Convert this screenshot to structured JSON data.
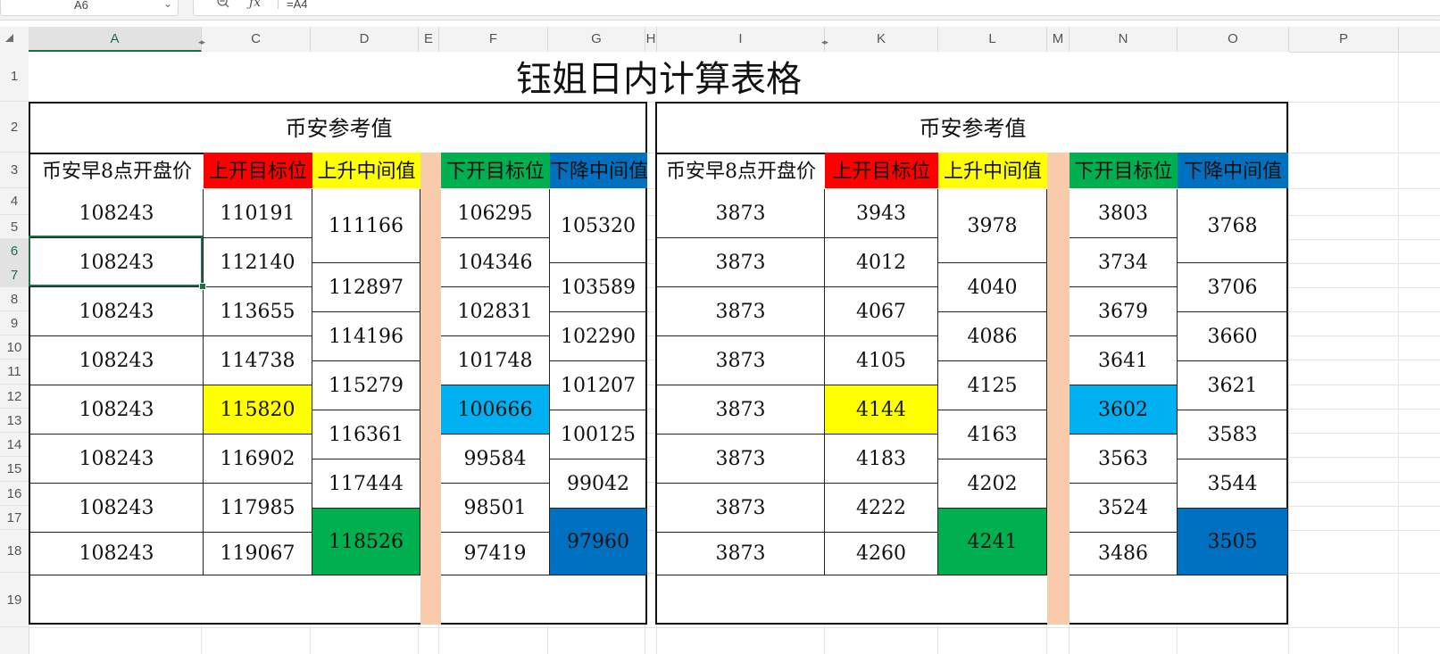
{
  "name_box": {
    "cell": "A6"
  },
  "formula": {
    "text": "=A4"
  },
  "colors": {
    "red": "#ff0000",
    "yellow": "#ffff00",
    "green": "#00b050",
    "blue": "#0070c0",
    "lightblue": "#00b0f0",
    "peach": "#f8cbad"
  },
  "columns": [
    "A",
    "C",
    "D",
    "E",
    "F",
    "G",
    "H",
    "I",
    "K",
    "L",
    "M",
    "N",
    "O",
    "P"
  ],
  "rows": [
    "1",
    "2",
    "3",
    "4",
    "5",
    "6",
    "7",
    "8",
    "9",
    "10",
    "11",
    "12",
    "13",
    "14",
    "15",
    "16",
    "17",
    "18",
    "19"
  ],
  "sheet": {
    "title": "钰姐日内计算表格",
    "left": {
      "section": "币安参考值",
      "headers": {
        "open": "币安早8点开盘价",
        "up_target": "上开目标位",
        "up_mid": "上升中间值",
        "down_target": "下开目标位",
        "down_mid": "下降中间值"
      },
      "open": [
        "108243",
        "108243",
        "108243",
        "108243",
        "108243",
        "108243",
        "108243",
        "108243"
      ],
      "up_target": [
        "110191",
        "112140",
        "113655",
        "114738",
        "115820",
        "116902",
        "117985",
        "119067"
      ],
      "up_mid": [
        "111166",
        "112897",
        "114196",
        "115279",
        "116361",
        "117444",
        "118526"
      ],
      "down_target": [
        "106295",
        "104346",
        "102831",
        "101748",
        "100666",
        "99584",
        "98501",
        "97419"
      ],
      "down_mid": [
        "105320",
        "103589",
        "102290",
        "101207",
        "100125",
        "99042",
        "97960"
      ]
    },
    "right": {
      "section": "币安参考值",
      "headers": {
        "open": "币安早8点开盘价",
        "up_target": "上开目标位",
        "up_mid": "上升中间值",
        "down_target": "下开目标位",
        "down_mid": "下降中间值"
      },
      "open": [
        "3873",
        "3873",
        "3873",
        "3873",
        "3873",
        "3873",
        "3873",
        "3873"
      ],
      "up_target": [
        "3943",
        "4012",
        "4067",
        "4105",
        "4144",
        "4183",
        "4222",
        "4260"
      ],
      "up_mid": [
        "3978",
        "4040",
        "4086",
        "4125",
        "4163",
        "4202",
        "4241"
      ],
      "down_target": [
        "3803",
        "3734",
        "3679",
        "3641",
        "3602",
        "3563",
        "3524",
        "3486"
      ],
      "down_mid": [
        "3768",
        "3706",
        "3660",
        "3621",
        "3583",
        "3544",
        "3505"
      ]
    }
  }
}
